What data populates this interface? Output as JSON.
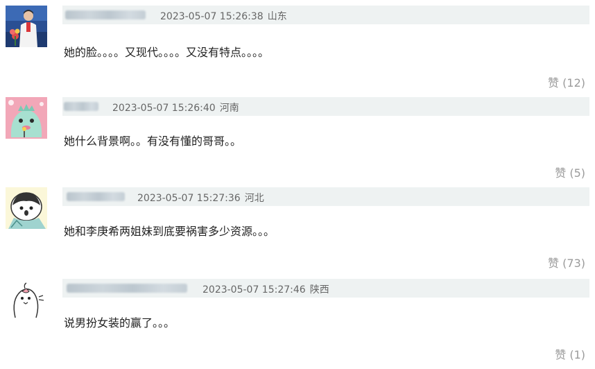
{
  "comments": [
    {
      "timestamp": "2023-05-07 15:26:38",
      "location": "山东",
      "text": "她的脸。。。。又现代。。。。又没有特点。。。。",
      "like_label": "赞",
      "like_count": "(12)",
      "avatar_icon": "athlete-photo-avatar"
    },
    {
      "timestamp": "2023-05-07 15:26:40",
      "location": "河南",
      "text": "她什么背景啊。。有没有懂的哥哥。。",
      "like_label": "赞",
      "like_count": "(5)",
      "avatar_icon": "cartoon-dinosaur-avatar"
    },
    {
      "timestamp": "2023-05-07 15:27:36",
      "location": "河北",
      "text": "她和李庚希两姐妹到底要祸害多少资源。。。",
      "like_label": "赞",
      "like_count": "(73)",
      "avatar_icon": "cartoon-penguin-avatar"
    },
    {
      "timestamp": "2023-05-07 15:27:46",
      "location": "陕西",
      "text": "说男扮女装的赢了。。。",
      "like_label": "赞",
      "like_count": "(1)",
      "avatar_icon": "sketch-bird-avatar"
    }
  ]
}
